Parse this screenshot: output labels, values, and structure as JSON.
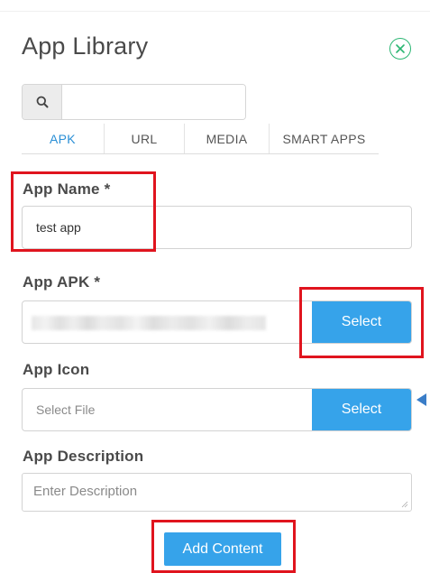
{
  "header": {
    "title": "App Library",
    "close_icon": "close-circle-icon"
  },
  "search": {
    "icon": "search-icon",
    "value": "",
    "placeholder": ""
  },
  "tabs": [
    {
      "label": "APK",
      "active": true
    },
    {
      "label": "URL",
      "active": false
    },
    {
      "label": "MEDIA",
      "active": false
    },
    {
      "label": "SMART APPS",
      "active": false
    }
  ],
  "form": {
    "app_name": {
      "label": "App Name *",
      "value": "test app"
    },
    "app_apk": {
      "label": "App APK *",
      "value_blurred": true,
      "button_label": "Select"
    },
    "app_icon": {
      "label": "App Icon",
      "placeholder": "Select File",
      "button_label": "Select"
    },
    "app_description": {
      "label": "App Description",
      "placeholder": "Enter Description"
    },
    "submit_label": "Add Content"
  },
  "colors": {
    "accent_blue": "#36a3ea",
    "active_tab": "#2a8fd6",
    "close_green": "#2bb673",
    "annotation_red": "#e0141e",
    "pointer_blue": "#3a7dc8"
  }
}
